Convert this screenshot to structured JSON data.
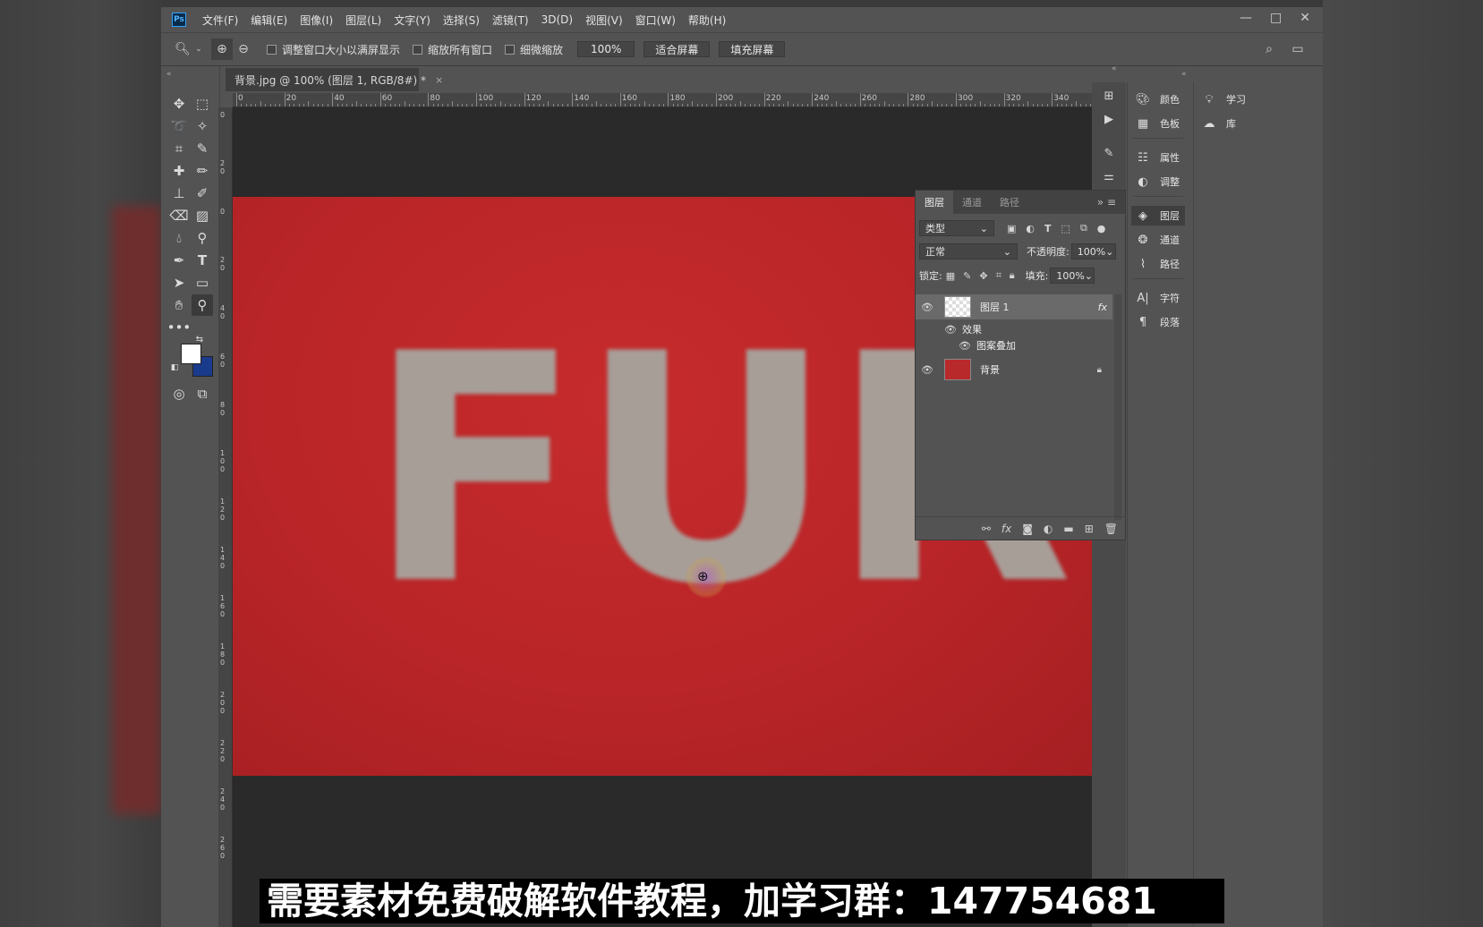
{
  "app": {
    "logo": "Ps"
  },
  "menu": [
    "文件(F)",
    "编辑(E)",
    "图像(I)",
    "图层(L)",
    "文字(Y)",
    "选择(S)",
    "滤镜(T)",
    "3D(D)",
    "视图(V)",
    "窗口(W)",
    "帮助(H)"
  ],
  "window_controls": {
    "minimize": "—",
    "maximize": "□",
    "close": "✕"
  },
  "options": {
    "resize_windows": "调整窗口大小以满屏显示",
    "zoom_all": "缩放所有窗口",
    "scrubby_zoom": "细微缩放",
    "zoom_value": "100%",
    "fit_screen": "适合屏幕",
    "fill_screen": "填充屏幕"
  },
  "document": {
    "tab_title": "背景.jpg @ 100% (图层 1, RGB/8#) *",
    "close": "×",
    "zoom_status": "100%"
  },
  "ruler_top": [
    "0",
    "20",
    "40",
    "60",
    "80",
    "100",
    "120",
    "140",
    "160",
    "180",
    "200",
    "220",
    "240",
    "260",
    "280",
    "300",
    "320",
    "340"
  ],
  "ruler_left": [
    "0",
    "20",
    "0",
    "20",
    "40",
    "60",
    "80",
    "100",
    "120",
    "140",
    "160",
    "180",
    "200",
    "220",
    "240",
    "260"
  ],
  "canvas": {
    "text": "FUR",
    "background_color": "#c62b2c",
    "fur_color": "#a89e98"
  },
  "colors": {
    "foreground": "#ffffff",
    "background": "#1a3a8c",
    "accent": "#2fa3ff"
  },
  "dock1": [
    {
      "icon": "palette-icon",
      "label": "颜色"
    },
    {
      "icon": "grid-icon",
      "label": "色板"
    },
    {
      "icon": "properties-icon",
      "label": "属性"
    },
    {
      "icon": "adjust-icon",
      "label": "调整"
    },
    {
      "icon": "layers-icon",
      "label": "图层"
    },
    {
      "icon": "channels-icon",
      "label": "通道"
    },
    {
      "icon": "paths-icon",
      "label": "路径"
    },
    {
      "icon": "character-icon",
      "label": "字符"
    },
    {
      "icon": "paragraph-icon",
      "label": "段落"
    }
  ],
  "dock2": [
    {
      "icon": "bulb-icon",
      "label": "学习"
    },
    {
      "icon": "cloud-icon",
      "label": "库"
    }
  ],
  "layers_panel": {
    "tabs": [
      "图层",
      "通道",
      "路径"
    ],
    "filter_label": "类型",
    "blend_mode": "正常",
    "opacity_label": "不透明度:",
    "opacity_value": "100%",
    "lock_label": "锁定:",
    "fill_label": "填充:",
    "fill_value": "100%",
    "layers": [
      {
        "name": "图层 1",
        "fx": "fx",
        "effects_label": "效果",
        "effect": "图案叠加"
      },
      {
        "name": "背景"
      }
    ]
  },
  "banner": {
    "text": "需要素材免费破解软件教程，加学习群：147754681"
  }
}
